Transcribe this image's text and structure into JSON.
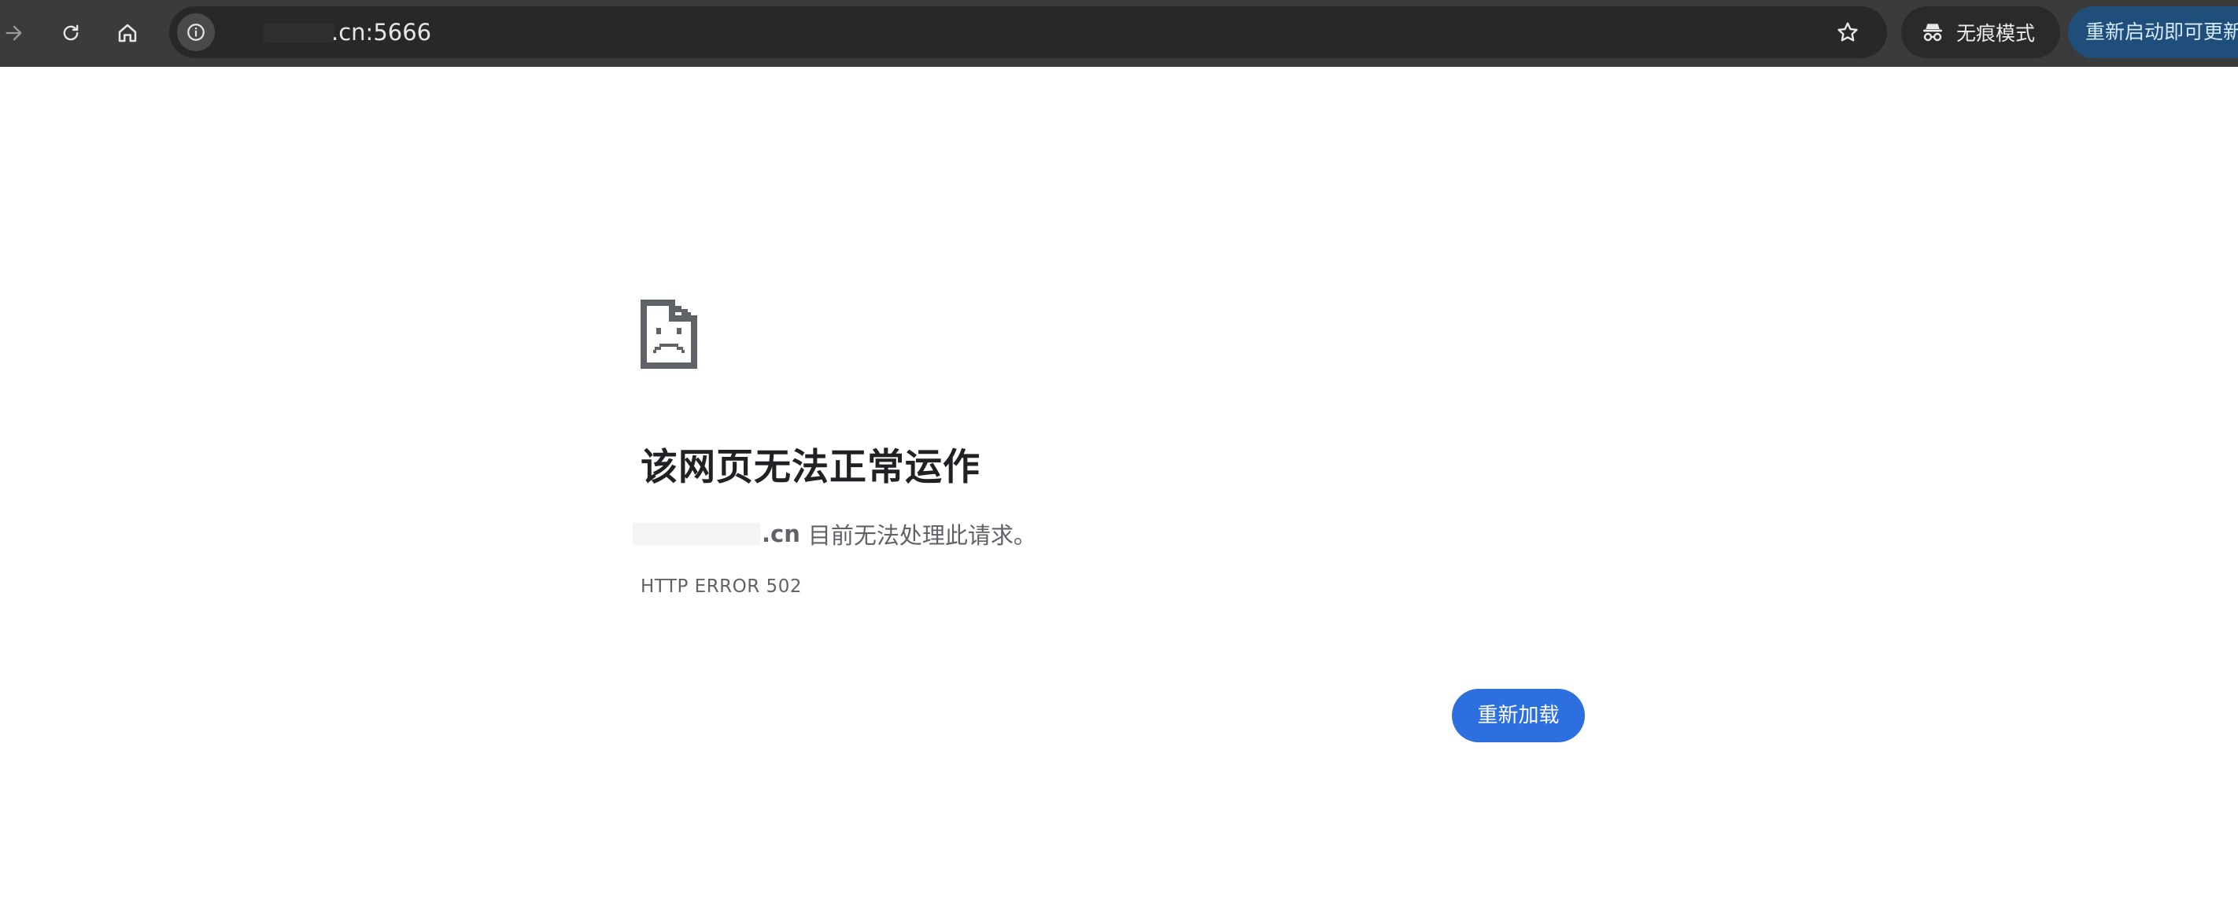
{
  "browser": {
    "address_bar": {
      "url_text": ".cn:5666"
    },
    "incognito": {
      "label": "无痕模式"
    },
    "update_button": {
      "label": "重新启动即可更新"
    },
    "icons": {
      "forward": "arrow-right-icon",
      "reload": "reload-icon",
      "home": "home-icon",
      "site_info": "info-icon",
      "bookmark": "star-icon",
      "incognito": "incognito-icon"
    }
  },
  "error_page": {
    "icon": "sad-page-icon",
    "title": "该网页无法正常运作",
    "host": ".cn",
    "description": "目前无法处理此请求。",
    "error_code": "HTTP ERROR 502",
    "reload_label": "重新加载"
  },
  "colors": {
    "toolbar_bg": "#3b3b3b",
    "omnibox_bg": "#282828",
    "accent_button": "#2d6fde",
    "update_chip": "#1f4e7a",
    "title_text": "#202124",
    "body_text": "#5f6368"
  }
}
